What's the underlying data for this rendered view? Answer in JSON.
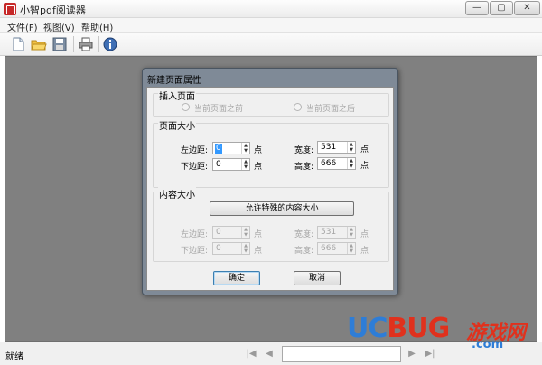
{
  "window": {
    "title": "小智pdf阅读器",
    "minimize": "—",
    "maximize": "▢",
    "close": "✕"
  },
  "menu": [
    {
      "label": "文件(F)"
    },
    {
      "label": "视图(V)"
    },
    {
      "label": "帮助(H)"
    }
  ],
  "toolbar": {
    "icons": [
      "new-document-icon",
      "open-folder-icon",
      "save-icon",
      "print-icon",
      "info-icon"
    ]
  },
  "dialog": {
    "title": "新建页面属性",
    "insert_group": {
      "label": "插入页面",
      "option_before": "当前页面之前",
      "option_after": "当前页面之后"
    },
    "page_size_group": {
      "label": "页面大小",
      "left_margin_label": "左边距:",
      "left_margin_value": "0",
      "bottom_margin_label": "下边距:",
      "bottom_margin_value": "0",
      "unit": "点",
      "width_label": "宽度:",
      "width_value": "531",
      "height_label": "高度:",
      "height_value": "666"
    },
    "content_group": {
      "label": "内容大小",
      "allow_button": "允许特殊的内容大小",
      "left_margin_label": "左边距:",
      "left_margin_value": "0",
      "bottom_margin_label": "下边距:",
      "bottom_margin_value": "0",
      "unit": "点",
      "width_label": "宽度:",
      "width_value": "531",
      "height_label": "高度:",
      "height_value": "666"
    },
    "ok_label": "确定",
    "cancel_label": "取消"
  },
  "status": {
    "text": "就绪",
    "nav": [
      "|◀",
      "◀",
      "▶",
      "▶|"
    ]
  },
  "watermark": {
    "uc": "UC",
    "bug": "BUG",
    "cn": "游戏网",
    "com": ".com"
  },
  "colors": {
    "workspace": "#808080",
    "dialog_frame": "#7f8a97",
    "watermark_blue": "#2e7dd7",
    "watermark_red": "#e0311d"
  }
}
